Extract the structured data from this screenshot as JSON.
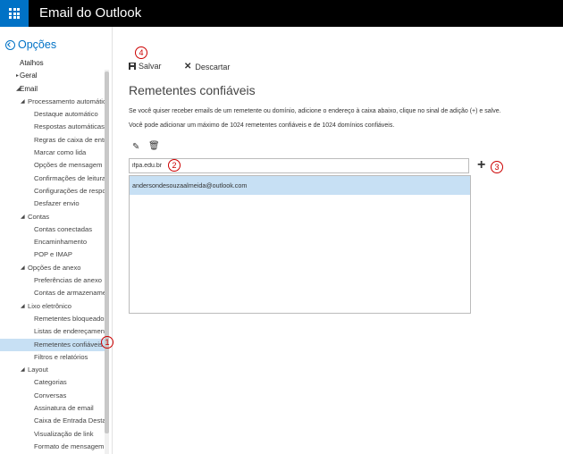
{
  "header": {
    "title": "Email do Outlook"
  },
  "sidebar": {
    "back_label": "Opções",
    "items": [
      {
        "label": "Atalhos",
        "level": 0,
        "caret": ""
      },
      {
        "label": "Geral",
        "level": 0,
        "caret": "right"
      },
      {
        "label": "Email",
        "level": 0,
        "caret": "down"
      },
      {
        "label": "Processamento automático",
        "level": 1,
        "caret": "down"
      },
      {
        "label": "Destaque automático",
        "level": 2,
        "caret": ""
      },
      {
        "label": "Respostas automáticas",
        "level": 2,
        "caret": ""
      },
      {
        "label": "Regras de caixa de entrada e limpeza",
        "level": 2,
        "caret": ""
      },
      {
        "label": "Marcar como lida",
        "level": 2,
        "caret": ""
      },
      {
        "label": "Opções de mensagem",
        "level": 2,
        "caret": ""
      },
      {
        "label": "Confirmações de leitura",
        "level": 2,
        "caret": ""
      },
      {
        "label": "Configurações de resposta",
        "level": 2,
        "caret": ""
      },
      {
        "label": "Desfazer envio",
        "level": 2,
        "caret": ""
      },
      {
        "label": "Contas",
        "level": 1,
        "caret": "down"
      },
      {
        "label": "Contas conectadas",
        "level": 2,
        "caret": ""
      },
      {
        "label": "Encaminhamento",
        "level": 2,
        "caret": ""
      },
      {
        "label": "POP e IMAP",
        "level": 2,
        "caret": ""
      },
      {
        "label": "Opções de anexo",
        "level": 1,
        "caret": "down"
      },
      {
        "label": "Preferências de anexo",
        "level": 2,
        "caret": ""
      },
      {
        "label": "Contas de armazenamento",
        "level": 2,
        "caret": ""
      },
      {
        "label": "Lixo eletrônico",
        "level": 1,
        "caret": "down"
      },
      {
        "label": "Remetentes bloqueados",
        "level": 2,
        "caret": ""
      },
      {
        "label": "Listas de endereçamento",
        "level": 2,
        "caret": ""
      },
      {
        "label": "Remetentes confiáveis",
        "level": 2,
        "caret": "",
        "selected": true
      },
      {
        "label": "Filtros e relatórios",
        "level": 2,
        "caret": ""
      },
      {
        "label": "Layout",
        "level": 1,
        "caret": "down"
      },
      {
        "label": "Categorias",
        "level": 2,
        "caret": ""
      },
      {
        "label": "Conversas",
        "level": 2,
        "caret": ""
      },
      {
        "label": "Assinatura de email",
        "level": 2,
        "caret": ""
      },
      {
        "label": "Caixa de Entrada Destaques",
        "level": 2,
        "caret": ""
      },
      {
        "label": "Visualização de link",
        "level": 2,
        "caret": ""
      },
      {
        "label": "Formato de mensagem",
        "level": 2,
        "caret": ""
      }
    ]
  },
  "toolbar": {
    "save_label": "Salvar",
    "discard_label": "Descartar"
  },
  "main": {
    "title": "Remetentes confiáveis",
    "description1": "Se você quiser receber emails de um remetente ou domínio, adicione o endereço à caixa abaixo, clique no sinal de adição (+) e salve.",
    "description2": "Você pode adicionar um máximo de 1024 remetentes confiáveis e de 1024 domínios confiáveis.",
    "input_value": "ifpa.edu.br",
    "list": [
      "andersondesouzaalmeida@outlook.com"
    ]
  },
  "annotations": [
    "1",
    "2",
    "3",
    "4"
  ],
  "colors": {
    "accent": "#0072c6",
    "selected": "#c7e0f4",
    "annotation": "#cc0000",
    "topbar": "#000000"
  }
}
